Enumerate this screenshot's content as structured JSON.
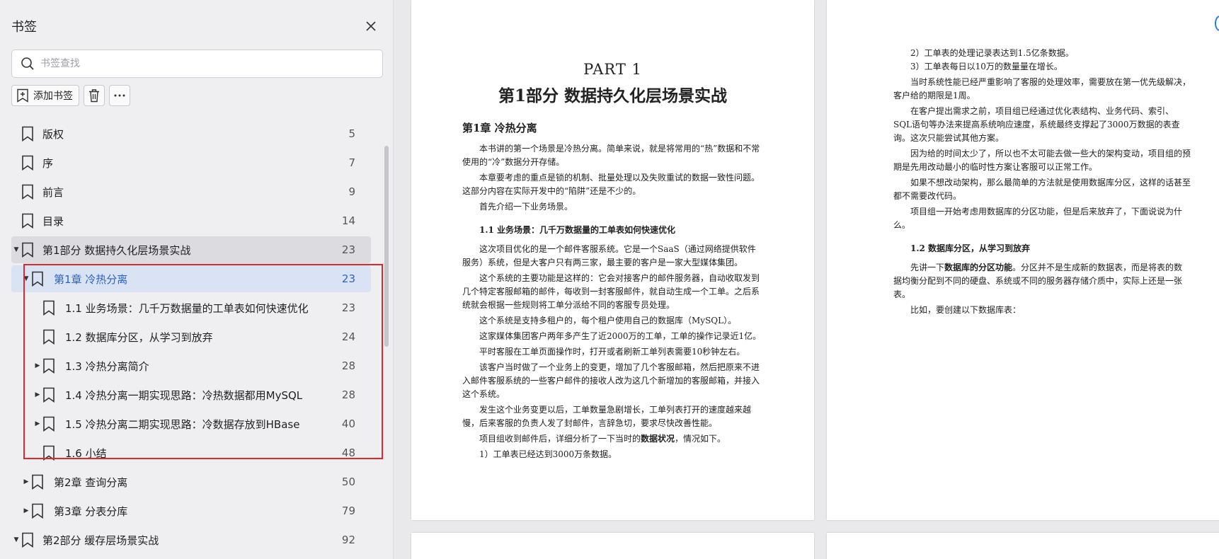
{
  "sidebar": {
    "title": "书签",
    "search_placeholder": "书签查找",
    "add_bookmark_label": "添加书签",
    "items": [
      {
        "label": "版权",
        "page": "5"
      },
      {
        "label": "序",
        "page": "7"
      },
      {
        "label": "前言",
        "page": "9"
      },
      {
        "label": "目录",
        "page": "14"
      },
      {
        "label": "第1部分 数据持久化层场景实战",
        "page": "23"
      },
      {
        "label": "第1章 冷热分离",
        "page": "23"
      },
      {
        "label": "1.1 业务场景：几千万数据量的工单表如何快速优化",
        "page": "23"
      },
      {
        "label": "1.2 数据库分区，从学习到放弃",
        "page": "24"
      },
      {
        "label": "1.3 冷热分离简介",
        "page": "28"
      },
      {
        "label": "1.4 冷热分离一期实现思路：冷热数据都用MySQL",
        "page": "28"
      },
      {
        "label": "1.5 冷热分离二期实现思路：冷数据存放到HBase",
        "page": "40"
      },
      {
        "label": "1.6 小结",
        "page": "48"
      },
      {
        "label": "第2章 查询分离",
        "page": "50"
      },
      {
        "label": "第3章 分表分库",
        "page": "79"
      },
      {
        "label": "第2部分 缓存层场景实战",
        "page": "92"
      }
    ]
  },
  "page1": {
    "part": "PART 1",
    "part_title": "第1部分  数据持久化层场景实战",
    "chapter": "第1章  冷热分离",
    "p1": "本书讲的第一个场景是冷热分离。简单来说，就是将常用的“热”数据和不常使用的“冷”数据分开存储。",
    "p2": "本章要考虑的重点是锁的机制、批量处理以及失败重试的数据一致性问题。这部分内容在实际开发中的“陷阱”还是不少的。",
    "p3": "首先介绍一下业务场景。",
    "sec": "1.1  业务场景：几千万数据量的工单表如何快速优化",
    "p4": "这次项目优化的是一个邮件客服系统。它是一个SaaS（通过网络提供软件服务）系统，但是大客户只有两三家，最主要的客户是一家大型媒体集团。",
    "p5": "这个系统的主要功能是这样的：它会对接客户的邮件服务器，自动收取发到几个特定客服邮箱的邮件，每收到一封客服邮件，就自动生成一个工单。之后系统就会根据一些规则将工单分派给不同的客服专员处理。",
    "p6": "这个系统是支持多租户的，每个租户使用自己的数据库（MySQL）。",
    "p7": "这家媒体集团客户两年多产生了近2000万的工单，工单的操作记录近1亿。",
    "p8": "平时客服在工单页面操作时，打开或者刷新工单列表需要10秒钟左右。",
    "p9": "该客户当时做了一个业务上的变更，增加了几个客服邮箱，然后把原来不进入邮件客服系统的一些客户邮件的接收人改为这几个新增加的客服邮箱，并接入这个系统。",
    "p10": "发生这个业务变更以后，工单数量急剧增长，工单列表打开的速度越来越慢，后来客服的负责人发了封邮件，言辞急切，要求尽快改善性能。",
    "p11a": "项目组收到邮件后，详细分析了一下当时的",
    "p11b": "数据状况",
    "p11c": "，情况如下。",
    "p12": "1）工单表已经达到3000万条数据。"
  },
  "page2": {
    "l1": "2）工单表的处理记录表达到1.5亿条数据。",
    "l2": "3）工单表每日以10万的数量量在增长。",
    "p1": "当时系统性能已经严重影响了客服的处理效率，需要放在第一优先级解决，客户给的期限是1周。",
    "p2": "在客户提出需求之前，项目组已经通过优化表结构、业务代码、索引、SQL语句等办法来提高系统响应速度，系统最终支撑起了3000万数据的表查询。这次只能尝试其他方案。",
    "p3": "因为给的时间太少了，所以也不太可能去做一些大的架构变动，项目组的预期是先用改动最小的临时性方案让客服可以正常工作。",
    "p4": "如果不想改动架构，那么最简单的方法就是使用数据库分区，这样的话甚至都不需要改代码。",
    "p5": "项目组一开始考虑用数据库的分区功能，但是后来放弃了，下面说说为什么。",
    "sec": "1.2  数据库分区，从学习到放弃",
    "p6a": "先讲一下",
    "p6b": "数据库的分区功能",
    "p6c": "。分区并不是生成新的数据表，而是将表的数据均衡分配到不同的硬盘、系统或不同的服务器存储介质中，实际上还是一张表。",
    "p7": "比如，要创建以下数据库表："
  }
}
